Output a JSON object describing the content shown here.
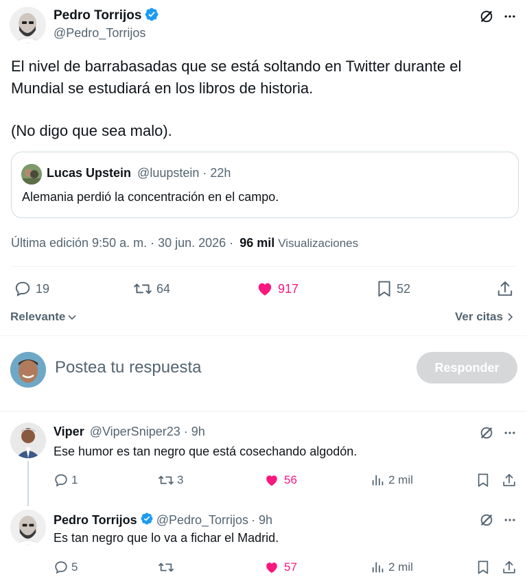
{
  "main_tweet": {
    "author_name": "Pedro Torrijos",
    "author_handle": "@Pedro_Torrijos",
    "text_line1": "El nivel de barrabasadas que se está soltando en Twitter durante el",
    "text_line2": "Mundial se estudiará en los libros de historia.",
    "text_line3": "(No digo que sea malo).",
    "quote": {
      "author_name": "Lucas Upstein",
      "author_handle": "@luupstein",
      "time": "· 22h",
      "text": "Alemania perdió la concentración en el campo."
    },
    "meta": {
      "edited": "Última edición 9:50 a. m. · 30 jun. 2026 ·",
      "views_count": "96 mil",
      "views_label": "Visualizaciones"
    },
    "actions": {
      "replies": "19",
      "reposts": "64",
      "likes": "917",
      "bookmarks": "52"
    }
  },
  "filters": {
    "sort": "Relevante",
    "quotes_link": "Ver citas"
  },
  "composer": {
    "placeholder": "Postea tu respuesta",
    "button": "Responder"
  },
  "replies": [
    {
      "author_name": "Viper",
      "author_handle": "@ViperSniper23",
      "time": "· 9h",
      "text": "Ese humor es tan negro que está cosechando algodón.",
      "replies": "1",
      "reposts": "3",
      "likes": "56",
      "views": "2 mil"
    },
    {
      "author_name": "Pedro Torrijos",
      "author_handle": "@Pedro_Torrijos",
      "time": "· 9h",
      "text": "Es tan negro que lo va a fichar el Madrid.",
      "replies": "5",
      "reposts": "",
      "likes": "57",
      "views": "2 mil"
    }
  ],
  "colors": {
    "text": "#0f1419",
    "secondary": "#536471",
    "like": "#f91880",
    "verified": "#1d9bf0",
    "border": "#cfd9de"
  }
}
